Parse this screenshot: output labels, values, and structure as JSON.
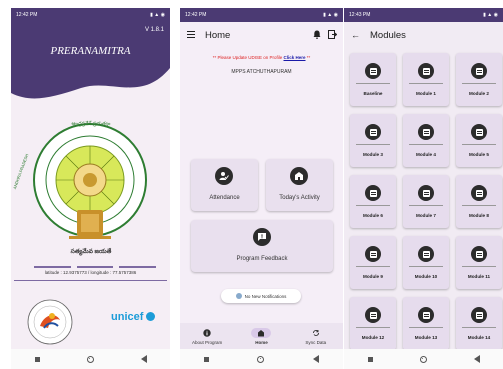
{
  "colors": {
    "header_purple": "#4b3a73",
    "accent": "#7d6aa2",
    "dark_icon": "#2c2c2c",
    "unicef_blue": "#1c9cd8",
    "alert_red": "#dd2222"
  },
  "splash": {
    "status_time": "12:42 PM",
    "version": "V 1.8.1",
    "title": "PRERANAMITRA",
    "emblem_top_text": "ఆంధ్రప్రదేశ్ ప్రభుత్వం",
    "emblem_left_text": "ANDHRA PRADESH",
    "emblem_bottom_text": "సత్యమేవ జయతే",
    "latlon": "latitude : 12.9375773 / longitude : 77.5757386",
    "partner_logo_text": "unicef"
  },
  "home": {
    "status_time": "12:42 PM",
    "title": "Home",
    "icons": [
      "menu-icon",
      "bell-icon",
      "logout-icon"
    ],
    "update_prefix": "** Please Update UDISE on Profile",
    "update_link": "Click Here",
    "update_suffix": "**",
    "school_name": "MPPS ATCHUTHAPURAM",
    "cards": {
      "attendance": "Attendance",
      "activity": "Today's Activity",
      "feedback": "Program Feedback"
    },
    "toast": "No New Notifications",
    "bottom_nav": {
      "about": "About Program",
      "home": "Home",
      "sync": "Sync Data"
    }
  },
  "modules": {
    "status_time": "12:43 PM",
    "title": "Modules",
    "items": [
      "Baseline",
      "Module 1",
      "Module 2",
      "Module 3",
      "Module 4",
      "Module 5",
      "Module 6",
      "Module 7",
      "Module 8",
      "Module 9",
      "Module 10",
      "Module 11",
      "Module 12",
      "Module 13",
      "Module 14"
    ]
  }
}
